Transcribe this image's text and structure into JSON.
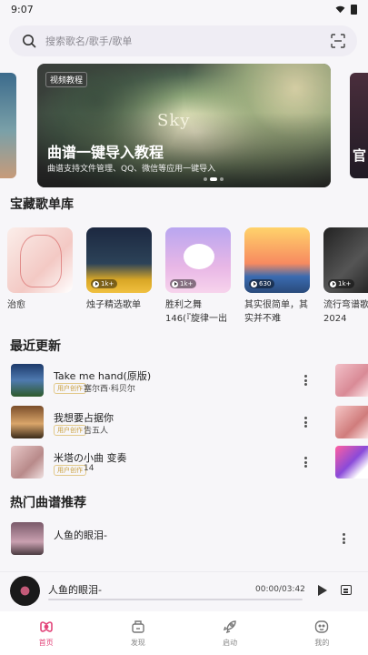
{
  "status_bar": {
    "time": "9:07"
  },
  "search": {
    "placeholder": "搜索歌名/歌手/歌单"
  },
  "banner": {
    "tag": "视频教程",
    "art_text": "Sky",
    "title": "曲谱一键导入教程",
    "subtitle": "曲谱支持文件管理、QQ、微信等应用一键导入",
    "side_right_text": "官",
    "page_count": 3,
    "active_page": 1
  },
  "sections": {
    "playlists_title": "宝藏歌单库",
    "recent_title": "最近更新",
    "hot_title": "热门曲谱推荐"
  },
  "playlists": [
    {
      "label": "治愈",
      "badge": ""
    },
    {
      "label": "烛子精选歌单",
      "badge": "1k+"
    },
    {
      "label": "胜利之舞146(『旋律一出 直...",
      "badge": "1k+"
    },
    {
      "label": "其实很简单，其实并不难",
      "badge": "630"
    },
    {
      "label": "流行弯谱歌2024",
      "badge": "1k+"
    }
  ],
  "recent": [
    {
      "title": "Take me hand(原版)",
      "tag": "用户创作",
      "author": "塞尔西·科贝尔"
    },
    {
      "title": "我想要占据你",
      "tag": "用户创作",
      "author": "告五人"
    },
    {
      "title": "米塔の小曲 变奏",
      "tag": "用户创作",
      "author": "14"
    }
  ],
  "hot": [
    {
      "title": "人鱼的眼泪-"
    }
  ],
  "player": {
    "title": "人鱼的眼泪-",
    "time": "00:00/03:42",
    "progress": 0
  },
  "tabs": [
    {
      "label": "首页",
      "icon": "home-icon",
      "active": true
    },
    {
      "label": "发现",
      "icon": "discover-icon",
      "active": false
    },
    {
      "label": "启动",
      "icon": "rocket-icon",
      "active": false
    },
    {
      "label": "我的",
      "icon": "profile-icon",
      "active": false
    }
  ],
  "colors": {
    "accent": "#e2457a",
    "background": "#f7f6f9",
    "tag_gold": "#c9a040"
  }
}
